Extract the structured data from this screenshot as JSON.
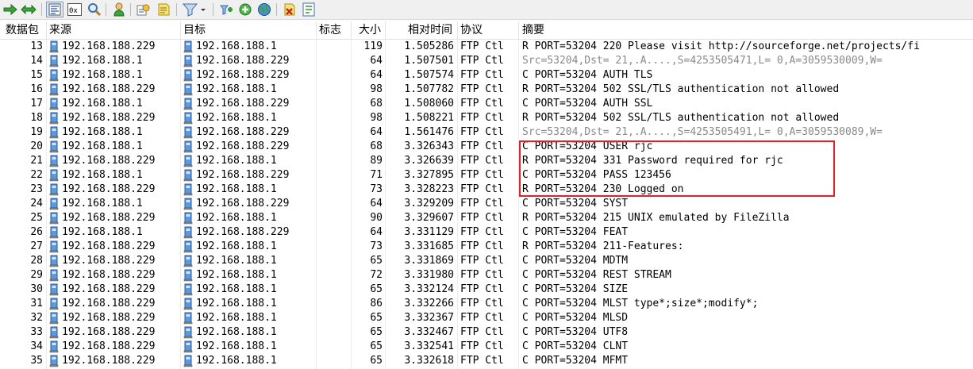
{
  "columns": {
    "num": "数据包",
    "src": "来源",
    "dst": "目标",
    "flag": "标志",
    "size": "大小",
    "time": "相对时间",
    "proto": "协议",
    "summary": "摘要"
  },
  "toolbar": {
    "icons": [
      "arrow-right-icon",
      "arrow-left-right-icon",
      "decode-view-icon",
      "hex-view-icon",
      "search-icon",
      "user-icon",
      "settings-icon",
      "notes-icon",
      "filter-icon",
      "add-filter-icon",
      "add-icon",
      "globe-icon",
      "delete-icon",
      "export-icon"
    ]
  },
  "colors": {
    "highlight_box": "#e3202a",
    "gray_text": "#8a8a8a",
    "ip_icon": "#3a7fd0"
  },
  "packets": [
    {
      "num": "13",
      "src": "192.168.188.229",
      "dst": "192.168.188.1",
      "size": "119",
      "time": "1.505286",
      "proto": "FTP Ctl",
      "summary": "R PORT=53204 220 Please visit http://sourceforge.net/projects/fi",
      "gray": false
    },
    {
      "num": "14",
      "src": "192.168.188.1",
      "dst": "192.168.188.229",
      "size": "64",
      "time": "1.507501",
      "proto": "FTP Ctl",
      "summary": "Src=53204,Dst=   21,.A....,S=4253505471,L=     0,A=3059530009,W=",
      "gray": true
    },
    {
      "num": "15",
      "src": "192.168.188.1",
      "dst": "192.168.188.229",
      "size": "64",
      "time": "1.507574",
      "proto": "FTP Ctl",
      "summary": "C PORT=53204 AUTH TLS",
      "gray": false
    },
    {
      "num": "16",
      "src": "192.168.188.229",
      "dst": "192.168.188.1",
      "size": "98",
      "time": "1.507782",
      "proto": "FTP Ctl",
      "summary": "R PORT=53204 502 SSL/TLS authentication not allowed",
      "gray": false
    },
    {
      "num": "17",
      "src": "192.168.188.1",
      "dst": "192.168.188.229",
      "size": "68",
      "time": "1.508060",
      "proto": "FTP Ctl",
      "summary": "C PORT=53204 AUTH SSL",
      "gray": false
    },
    {
      "num": "18",
      "src": "192.168.188.229",
      "dst": "192.168.188.1",
      "size": "98",
      "time": "1.508221",
      "proto": "FTP Ctl",
      "summary": "R PORT=53204 502 SSL/TLS authentication not allowed",
      "gray": false
    },
    {
      "num": "19",
      "src": "192.168.188.1",
      "dst": "192.168.188.229",
      "size": "64",
      "time": "1.561476",
      "proto": "FTP Ctl",
      "summary": "Src=53204,Dst=   21,.A....,S=4253505491,L=     0,A=3059530089,W=",
      "gray": true
    },
    {
      "num": "20",
      "src": "192.168.188.1",
      "dst": "192.168.188.229",
      "size": "68",
      "time": "3.326343",
      "proto": "FTP Ctl",
      "summary": "C PORT=53204 USER rjc",
      "gray": false
    },
    {
      "num": "21",
      "src": "192.168.188.229",
      "dst": "192.168.188.1",
      "size": "89",
      "time": "3.326639",
      "proto": "FTP Ctl",
      "summary": "R PORT=53204 331 Password required for rjc",
      "gray": false
    },
    {
      "num": "22",
      "src": "192.168.188.1",
      "dst": "192.168.188.229",
      "size": "71",
      "time": "3.327895",
      "proto": "FTP Ctl",
      "summary": "C PORT=53204 PASS 123456",
      "gray": false
    },
    {
      "num": "23",
      "src": "192.168.188.229",
      "dst": "192.168.188.1",
      "size": "73",
      "time": "3.328223",
      "proto": "FTP Ctl",
      "summary": "R PORT=53204 230 Logged on",
      "gray": false
    },
    {
      "num": "24",
      "src": "192.168.188.1",
      "dst": "192.168.188.229",
      "size": "64",
      "time": "3.329209",
      "proto": "FTP Ctl",
      "summary": "C PORT=53204 SYST",
      "gray": false
    },
    {
      "num": "25",
      "src": "192.168.188.229",
      "dst": "192.168.188.1",
      "size": "90",
      "time": "3.329607",
      "proto": "FTP Ctl",
      "summary": "R PORT=53204 215 UNIX emulated by FileZilla",
      "gray": false
    },
    {
      "num": "26",
      "src": "192.168.188.1",
      "dst": "192.168.188.229",
      "size": "64",
      "time": "3.331129",
      "proto": "FTP Ctl",
      "summary": "C PORT=53204 FEAT",
      "gray": false
    },
    {
      "num": "27",
      "src": "192.168.188.229",
      "dst": "192.168.188.1",
      "size": "73",
      "time": "3.331685",
      "proto": "FTP Ctl",
      "summary": "R PORT=53204 211-Features:",
      "gray": false
    },
    {
      "num": "28",
      "src": "192.168.188.229",
      "dst": "192.168.188.1",
      "size": "65",
      "time": "3.331869",
      "proto": "FTP Ctl",
      "summary": "C PORT=53204 MDTM",
      "gray": false
    },
    {
      "num": "29",
      "src": "192.168.188.229",
      "dst": "192.168.188.1",
      "size": "72",
      "time": "3.331980",
      "proto": "FTP Ctl",
      "summary": "C PORT=53204 REST STREAM",
      "gray": false
    },
    {
      "num": "30",
      "src": "192.168.188.229",
      "dst": "192.168.188.1",
      "size": "65",
      "time": "3.332124",
      "proto": "FTP Ctl",
      "summary": "C PORT=53204 SIZE",
      "gray": false
    },
    {
      "num": "31",
      "src": "192.168.188.229",
      "dst": "192.168.188.1",
      "size": "86",
      "time": "3.332266",
      "proto": "FTP Ctl",
      "summary": "C PORT=53204 MLST type*;size*;modify*;",
      "gray": false
    },
    {
      "num": "32",
      "src": "192.168.188.229",
      "dst": "192.168.188.1",
      "size": "65",
      "time": "3.332367",
      "proto": "FTP Ctl",
      "summary": "C PORT=53204 MLSD",
      "gray": false
    },
    {
      "num": "33",
      "src": "192.168.188.229",
      "dst": "192.168.188.1",
      "size": "65",
      "time": "3.332467",
      "proto": "FTP Ctl",
      "summary": "C PORT=53204 UTF8",
      "gray": false
    },
    {
      "num": "34",
      "src": "192.168.188.229",
      "dst": "192.168.188.1",
      "size": "65",
      "time": "3.332541",
      "proto": "FTP Ctl",
      "summary": "C PORT=53204 CLNT",
      "gray": false
    },
    {
      "num": "35",
      "src": "192.168.188.229",
      "dst": "192.168.188.1",
      "size": "65",
      "time": "3.332618",
      "proto": "FTP Ctl",
      "summary": "C PORT=53204 MFMT",
      "gray": false
    }
  ]
}
